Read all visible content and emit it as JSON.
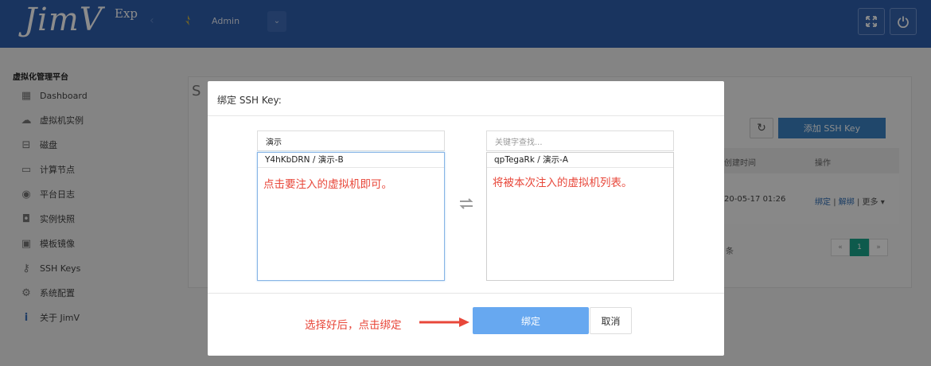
{
  "app": {
    "brand": "JimV",
    "brand_sup": "Exp",
    "user_name": "Admin"
  },
  "sidebar": {
    "title": "虚拟化管理平台",
    "items": [
      {
        "label": "Dashboard",
        "icon": "dashboard-icon"
      },
      {
        "label": "虚拟机实例",
        "icon": "cloud-icon"
      },
      {
        "label": "磁盘",
        "icon": "disk-icon"
      },
      {
        "label": "计算节点",
        "icon": "monitor-icon"
      },
      {
        "label": "平台日志",
        "icon": "eye-icon"
      },
      {
        "label": "实例快照",
        "icon": "camera-icon"
      },
      {
        "label": "模板镜像",
        "icon": "image-icon"
      },
      {
        "label": "SSH Keys",
        "icon": "key-icon"
      },
      {
        "label": "系统配置",
        "icon": "gear-icon"
      },
      {
        "label": "关于 JimV",
        "icon": "info-icon"
      }
    ]
  },
  "background": {
    "page_title": "S",
    "add_button": "添加 SSH Key",
    "table": {
      "headers": [
        "创建时间",
        "操作"
      ],
      "row": {
        "created": "20-05-17 01:26",
        "action_bind": "绑定",
        "action_unbind": "解绑",
        "action_more": "更多",
        "sep": "|"
      }
    },
    "footer_text": "条",
    "pagination": {
      "prev": "«",
      "current": "1",
      "next": "»"
    }
  },
  "modal": {
    "title": "绑定 SSH Key:",
    "left_filter_value": "演示",
    "right_filter_placeholder": "关键字查找...",
    "left_list": [
      "Y4hKbDRN / 演示-B"
    ],
    "right_list": [
      "qpTegaRk / 演示-A"
    ],
    "left_annotation": "点击要注入的虚拟机即可。",
    "right_annotation": "将被本次注入的虚拟机列表。",
    "bottom_annotation": "选择好后，点击绑定",
    "bind_button": "绑定",
    "cancel_button": "取消"
  },
  "colors": {
    "topbar": "#2f5fae",
    "primary_button": "#3b82c4",
    "bind_button": "#67a8f0",
    "annotation_red": "#e8473a",
    "pager_active": "#1aa58b"
  }
}
